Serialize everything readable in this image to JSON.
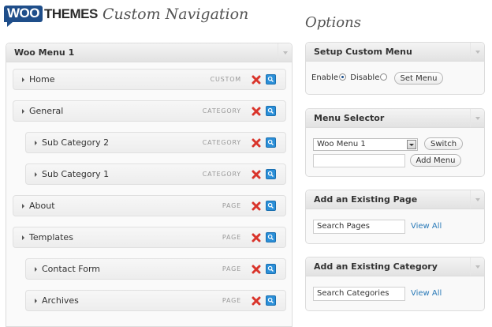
{
  "header": {
    "logo_woo": "WOO",
    "logo_themes": "THEMES",
    "title": "Custom Navigation"
  },
  "options_title": "Options",
  "menu": {
    "title": "Woo Menu 1",
    "items": [
      {
        "label": "Home",
        "type": "CUSTOM"
      },
      {
        "label": "General",
        "type": "CATEGORY"
      },
      {
        "label": "Sub Category 2",
        "type": "CATEGORY"
      },
      {
        "label": "Sub Category 1",
        "type": "CATEGORY"
      },
      {
        "label": "About",
        "type": "PAGE"
      },
      {
        "label": "Templates",
        "type": "PAGE"
      },
      {
        "label": "Contact Form",
        "type": "PAGE"
      },
      {
        "label": "Archives",
        "type": "PAGE"
      }
    ]
  },
  "setup": {
    "title": "Setup Custom Menu",
    "enable_label": "Enable",
    "disable_label": "Disable",
    "enabled": true,
    "set_menu_label": "Set Menu"
  },
  "selector": {
    "title": "Menu Selector",
    "selected": "Woo Menu 1",
    "switch_label": "Switch",
    "new_menu_value": "",
    "add_menu_label": "Add Menu"
  },
  "existing_page": {
    "title": "Add an Existing Page",
    "search_value": "Search Pages",
    "view_all_label": "View All"
  },
  "existing_category": {
    "title": "Add an Existing Category",
    "search_value": "Search Categories",
    "view_all_label": "View All"
  },
  "colors": {
    "brand": "#1f4e8a",
    "delete_icon": "#d9342b",
    "edit_icon": "#2b8fd8",
    "link": "#2a7ab8"
  }
}
